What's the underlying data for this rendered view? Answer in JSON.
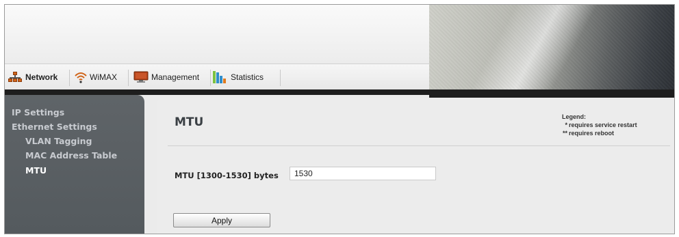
{
  "nav": {
    "tabs": [
      {
        "label": "Network",
        "icon": "network-icon",
        "active": true
      },
      {
        "label": "WiMAX",
        "icon": "wimax-signal-icon",
        "active": false
      },
      {
        "label": "Management",
        "icon": "management-monitor-icon",
        "active": false
      },
      {
        "label": "Statistics",
        "icon": "statistics-chart-icon",
        "active": false
      }
    ]
  },
  "sidebar": {
    "items": [
      {
        "label": "IP Settings",
        "level": 1
      },
      {
        "label": "Ethernet Settings",
        "level": 1
      },
      {
        "label": "VLAN Tagging",
        "level": 2
      },
      {
        "label": "MAC Address Table",
        "level": 2
      },
      {
        "label": "MTU",
        "level": 2,
        "active": true
      }
    ]
  },
  "main": {
    "title": "MTU",
    "legend": {
      "title": "Legend:",
      "items": [
        {
          "mark": "*",
          "text": "requires service restart"
        },
        {
          "mark": "**",
          "text": "requires reboot"
        }
      ]
    },
    "mtu_field": {
      "label": "MTU [1300-1530] bytes",
      "value": "1530"
    },
    "apply_label": "Apply"
  },
  "colors": {
    "sidebar_bg": "#5a5f63",
    "accent_orange": "#d0651a",
    "content_bg": "#ececec"
  }
}
